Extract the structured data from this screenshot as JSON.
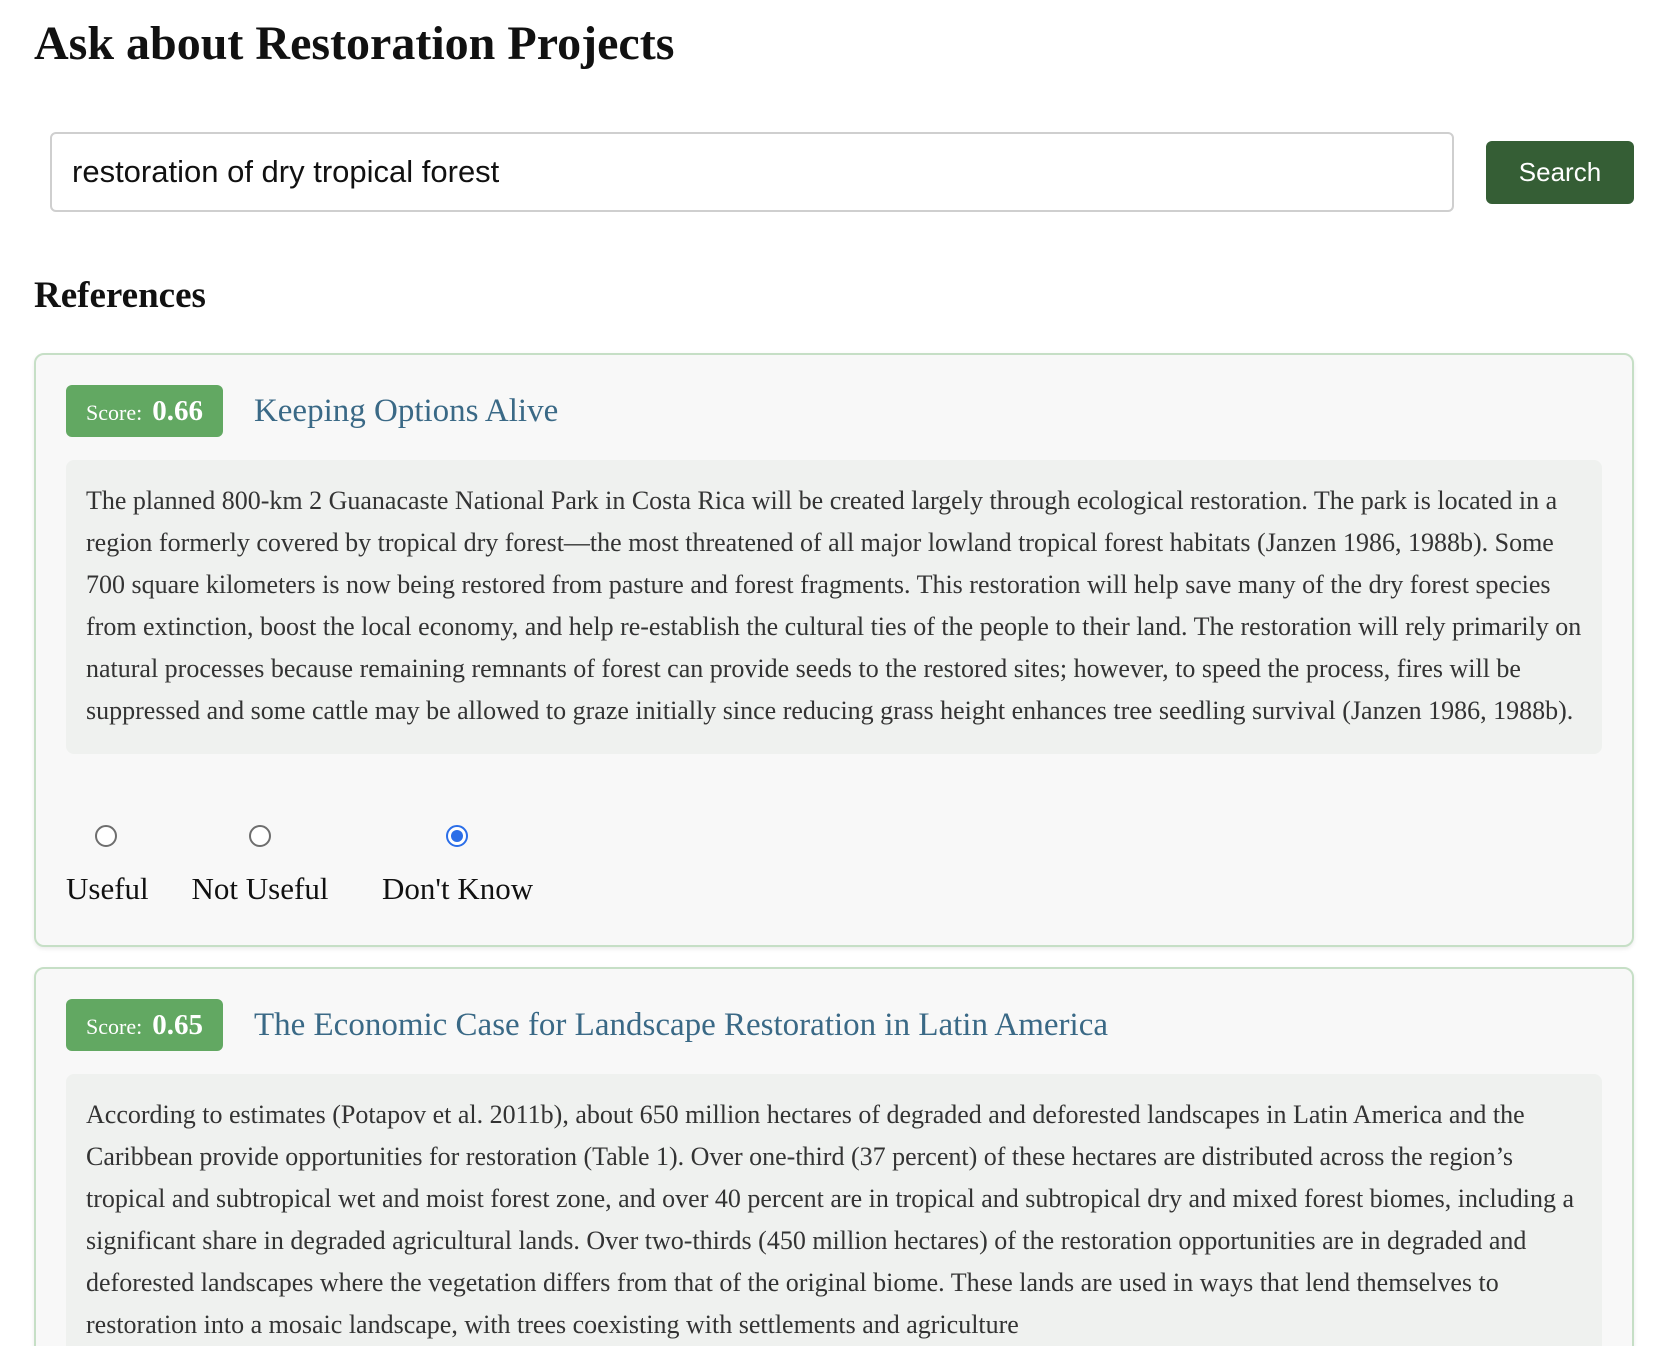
{
  "page": {
    "title": "Ask about Restoration Projects"
  },
  "search": {
    "value": "restoration of dry tropical forest",
    "button_label": "Search"
  },
  "references": {
    "heading": "References",
    "items": [
      {
        "score_label": "Score:",
        "score": "0.66",
        "title": "Keeping Options Alive",
        "excerpt": "The planned 800-km 2 Guanacaste National Park in Costa Rica will be created largely through ecological restoration. The park is located in a region formerly covered by tropical dry forest—the most threatened of all major lowland tropical forest habitats (Janzen 1986, 1988b). Some 700 square kilometers is now being restored from pasture and forest fragments. This restoration will help save many of the dry forest species from extinction, boost the local economy, and help re-establish the cultural ties of the people to their land. The restoration will rely primarily on natural processes because remaining remnants of forest can provide seeds to the restored sites; however, to speed the process, fires will be suppressed and some cattle may be allowed to graze initially since reducing grass height enhances tree seedling survival (Janzen 1986, 1988b).",
        "rating_options": [
          "Useful",
          "Not Useful",
          "Don't Know"
        ],
        "selected_rating": "Don't Know"
      },
      {
        "score_label": "Score:",
        "score": "0.65",
        "title": "The Economic Case for Landscape Restoration in Latin America",
        "excerpt": "According to estimates (Potapov et al. 2011b), about 650 million hectares of degraded and deforested landscapes in Latin America and the Caribbean provide opportunities for restoration (Table 1). Over one-third (37 percent) of these hectares are distributed across the region’s tropical and subtropical wet and moist forest zone, and over 40 percent are in tropical and subtropical dry and mixed forest biomes, including a significant share in degraded agricultural lands. Over two-thirds (450 million hectares) of the restoration opportunities are in degraded and deforested landscapes where the vegetation differs from that of the original biome. These lands are used in ways that lend themselves to restoration into a mosaic landscape, with trees coexisting with settlements and agriculture"
      }
    ]
  },
  "colors": {
    "search_button": "#355e35",
    "score_badge": "#62a862",
    "card_title": "#3a6986",
    "card_border": "#c6dfc6",
    "radio_selected": "#2b6ee8"
  }
}
